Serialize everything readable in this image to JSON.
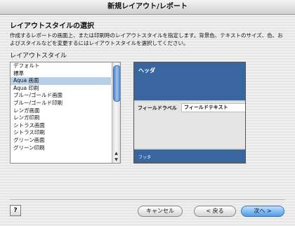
{
  "window": {
    "title": "新規レイアウト/レポート"
  },
  "page": {
    "heading": "レイアウトスタイルの選択",
    "description": "作成するレポートの画面上、または印刷時のレイアウトスタイルを指定します。背景色、テキストのサイズ、色、およびスタイルなどを変更するにはレイアウトスタイルを選択してください。",
    "list_label": "レイアウトスタイル"
  },
  "styles": {
    "items": [
      "デフォルト",
      "標準",
      "Aqua 画面",
      "Aqua 印刷",
      "ブルー/ゴールド画面",
      "ブルー/ゴールド印刷",
      "レンガ画面",
      "レンガ印刷",
      "シトラス画面",
      "シトラス印刷",
      "グリーン画面",
      "グリーン印刷"
    ],
    "selected": "Aqua 画面"
  },
  "preview": {
    "header": "ヘッダ",
    "field_label": "フィールドラベル",
    "field_text": "フィールドテキスト",
    "footer": "フッタ",
    "color": "#3a66a0"
  },
  "buttons": {
    "help": "?",
    "cancel": "キャンセル",
    "back": "< 戻る",
    "next": "次へ >"
  }
}
